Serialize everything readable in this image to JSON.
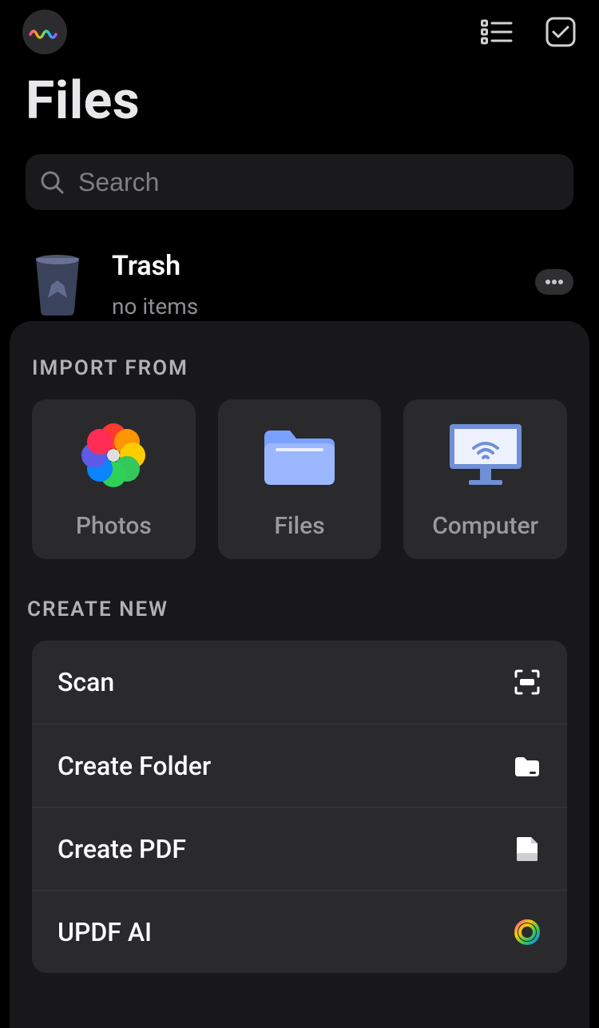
{
  "header": {
    "title": "Files"
  },
  "search": {
    "placeholder": "Search",
    "value": ""
  },
  "items": [
    {
      "title": "Trash",
      "subtitle": "no items"
    }
  ],
  "sheet": {
    "importLabel": "IMPORT FROM",
    "importTiles": [
      {
        "label": "Photos",
        "icon": "photos"
      },
      {
        "label": "Files",
        "icon": "files-folder"
      },
      {
        "label": "Computer",
        "icon": "computer"
      }
    ],
    "createLabel": "CREATE NEW",
    "createActions": [
      {
        "label": "Scan",
        "icon": "scan"
      },
      {
        "label": "Create Folder",
        "icon": "folder"
      },
      {
        "label": "Create PDF",
        "icon": "pdf"
      },
      {
        "label": "UPDF AI",
        "icon": "updf-ai"
      }
    ]
  }
}
